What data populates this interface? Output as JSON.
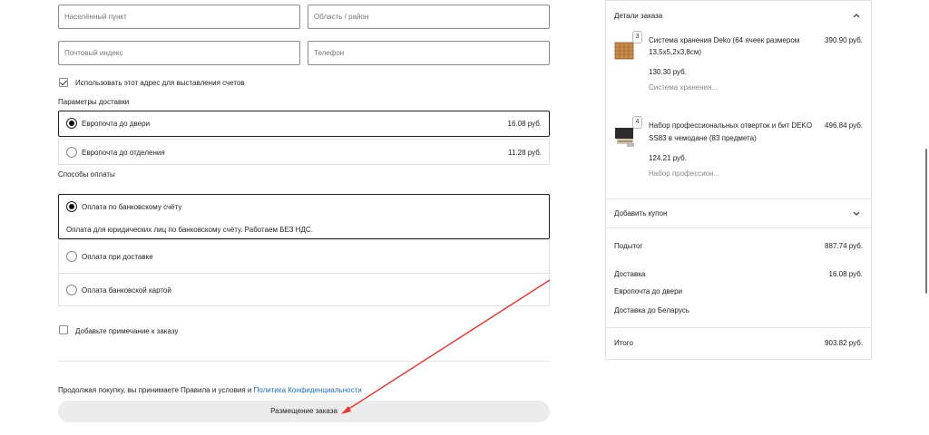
{
  "address": {
    "locality_placeholder": "Населённый пункт",
    "region_placeholder": "Область / район",
    "postcode_placeholder": "Почтовый индекс",
    "phone_placeholder": "Телефон",
    "billing_same_label": "Использовать этот адрес для выставления счетов"
  },
  "delivery": {
    "heading": "Параметры доставки",
    "options": [
      {
        "label": "Европочта до двери",
        "price": "16.08 руб.",
        "selected": true
      },
      {
        "label": "Европочта до отделения",
        "price": "11.28 руб.",
        "selected": false
      }
    ]
  },
  "payment": {
    "heading": "Способы оплаты",
    "options": [
      {
        "label": "Оплата по банковскому счёту",
        "selected": true,
        "note": "Оплата для юридических лиц по банковскому счёту. Работаем БЕЗ НДС."
      },
      {
        "label": "Оплата при доставке",
        "selected": false
      },
      {
        "label": "Оплата банковской картой",
        "selected": false
      }
    ]
  },
  "note_checkbox_label": "Добавьте примечание к заказу",
  "terms": {
    "text": "Продолжая покупку, вы принимаете Правила и условия и",
    "link": "Политика Конфиденциальности"
  },
  "place_order_label": "Размещение заказа",
  "summary": {
    "header": "Детали заказа",
    "items": [
      {
        "qty": "3",
        "name_line1": "Система хранения Deko (64 ячеек размером",
        "name_line2": "13,5x5,2x3,8см)",
        "total": "390.90 руб.",
        "unit_price": "130.30 руб.",
        "short": "Система хранения..."
      },
      {
        "qty": "4",
        "name_line1": "Набор профессиональных отверток и бит DEKO",
        "name_line2": "SS83 в чемодане (83 предмета)",
        "total": "496.84 руб.",
        "unit_price": "124.21 руб.",
        "short": "Набор профессион..."
      }
    ],
    "coupon_label": "Добавить купон",
    "subtotal_label": "Подытог",
    "subtotal_value": "887.74 руб.",
    "shipping_label": "Доставка",
    "shipping_value": "16.08 руб.",
    "shipping_method": "Европочта до двери",
    "shipping_destination": "Доставка до Беларусь",
    "total_label": "Итого",
    "total_value": "903.82 руб."
  },
  "colors": {
    "annotation_arrow": "#e53935",
    "link": "#1f6fb5",
    "button_bg": "#ececec"
  }
}
